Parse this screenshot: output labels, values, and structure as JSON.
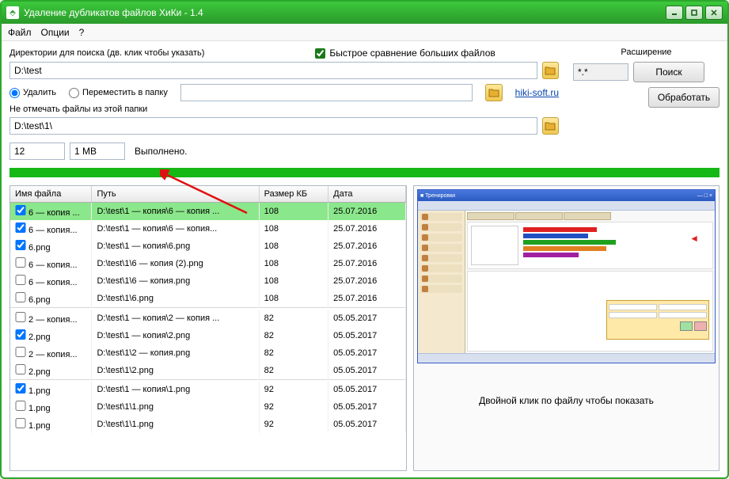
{
  "window": {
    "title": "Удаление дубликатов файлов ХиКи - 1.4"
  },
  "menu": {
    "file": "Файл",
    "options": "Опции",
    "help": "?"
  },
  "labels": {
    "dirs": "Директории для поиска (дв. клик чтобы указать)",
    "fastcompare": "Быстрое сравнение больших файлов",
    "extension": "Расширение",
    "delete": "Удалить",
    "movefolder": "Переместить в папку",
    "nomark": "Не отмечать файлы из этой папки",
    "status": "Выполнено."
  },
  "inputs": {
    "searchdir": "D:\\test",
    "movefolder": "",
    "nomarkdir": "D:\\test\\1\\",
    "count": "12",
    "size": "1 MB",
    "ext": "*.*"
  },
  "buttons": {
    "search": "Поиск",
    "process": "Обработать"
  },
  "link": "hiki-soft.ru",
  "table": {
    "headers": {
      "name": "Имя файла",
      "path": "Путь",
      "size": "Размер КБ",
      "date": "Дата"
    },
    "rows": [
      {
        "checked": true,
        "selected": true,
        "name": "6 — копия ...",
        "path": "D:\\test\\1 — копия\\6 — копия ...",
        "size": "108",
        "date": "25.07.2016"
      },
      {
        "checked": true,
        "selected": false,
        "name": "6 — копия...",
        "path": "D:\\test\\1 — копия\\6 — копия...",
        "size": "108",
        "date": "25.07.2016"
      },
      {
        "checked": true,
        "selected": false,
        "name": "6.png",
        "path": "D:\\test\\1 — копия\\6.png",
        "size": "108",
        "date": "25.07.2016"
      },
      {
        "checked": false,
        "selected": false,
        "name": "6 — копия...",
        "path": "D:\\test\\1\\6 — копия (2).png",
        "size": "108",
        "date": "25.07.2016"
      },
      {
        "checked": false,
        "selected": false,
        "name": "6 — копия...",
        "path": "D:\\test\\1\\6 — копия.png",
        "size": "108",
        "date": "25.07.2016"
      },
      {
        "checked": false,
        "selected": false,
        "name": "6.png",
        "path": "D:\\test\\1\\6.png",
        "size": "108",
        "date": "25.07.2016"
      },
      {
        "sep": true
      },
      {
        "checked": false,
        "selected": false,
        "name": "2 — копия...",
        "path": "D:\\test\\1 — копия\\2 — копия ...",
        "size": "82",
        "date": "05.05.2017"
      },
      {
        "checked": true,
        "selected": false,
        "name": "2.png",
        "path": "D:\\test\\1 — копия\\2.png",
        "size": "82",
        "date": "05.05.2017"
      },
      {
        "checked": false,
        "selected": false,
        "name": "2 — копия...",
        "path": "D:\\test\\1\\2 — копия.png",
        "size": "82",
        "date": "05.05.2017"
      },
      {
        "checked": false,
        "selected": false,
        "name": "2.png",
        "path": "D:\\test\\1\\2.png",
        "size": "82",
        "date": "05.05.2017"
      },
      {
        "sep": true
      },
      {
        "checked": true,
        "selected": false,
        "name": "1.png",
        "path": "D:\\test\\1 — копия\\1.png",
        "size": "92",
        "date": "05.05.2017"
      },
      {
        "checked": false,
        "selected": false,
        "name": "1.png",
        "path": "D:\\test\\1\\1.png",
        "size": "92",
        "date": "05.05.2017"
      },
      {
        "checked": false,
        "selected": false,
        "name": "1.png",
        "path": "D:\\test\\1\\1.png",
        "size": "92",
        "date": "05.05.2017"
      }
    ]
  },
  "preview": {
    "caption": "Двойной клик по файлу чтобы показать"
  }
}
